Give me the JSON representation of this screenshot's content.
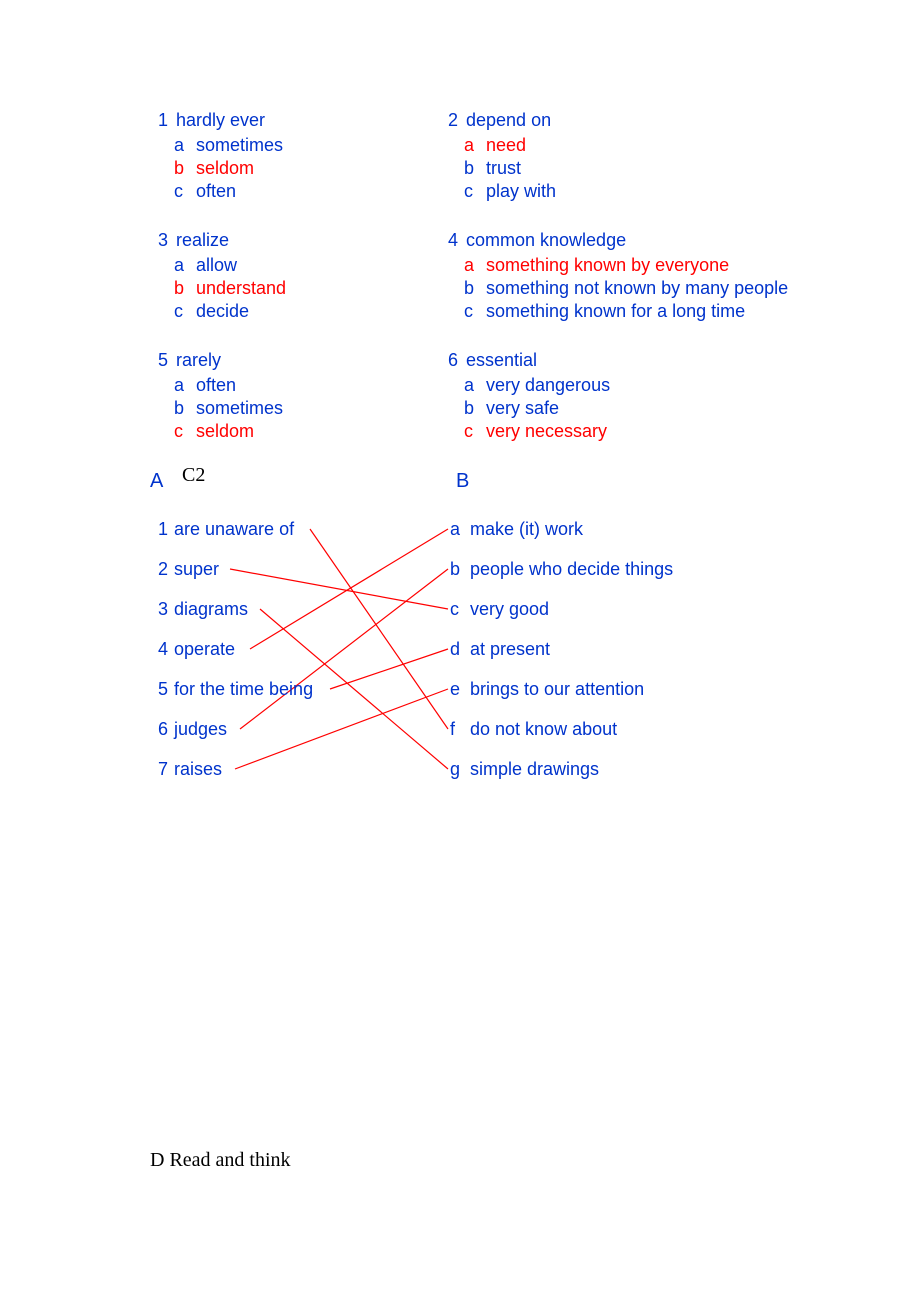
{
  "mc": {
    "q1": {
      "num": "1",
      "text": "hardly ever",
      "a": "sometimes",
      "b": "seldom",
      "c": "often",
      "correct": "b"
    },
    "q2": {
      "num": "2",
      "text": "depend on",
      "a": "need",
      "b": "trust",
      "c": "play with",
      "correct": "a"
    },
    "q3": {
      "num": "3",
      "text": "realize",
      "a": "allow",
      "b": "understand",
      "c": "decide",
      "correct": "b"
    },
    "q4": {
      "num": "4",
      "text": "common knowledge",
      "a": "something known by everyone",
      "b": "something not known by many people",
      "c": "something known for a long time",
      "correct": "a"
    },
    "q5": {
      "num": "5",
      "text": "rarely",
      "a": "often",
      "b": "sometimes",
      "c": "seldom",
      "correct": "c"
    },
    "q6": {
      "num": "6",
      "text": "essential",
      "a": "very dangerous",
      "b": "very safe",
      "c": "very necessary",
      "correct": "c"
    }
  },
  "section_c2_label": "C2",
  "match": {
    "header_a": "A",
    "header_b": "B",
    "left": {
      "1": {
        "num": "1",
        "text": "are unaware of"
      },
      "2": {
        "num": "2",
        "text": "super"
      },
      "3": {
        "num": "3",
        "text": "diagrams"
      },
      "4": {
        "num": "4",
        "text": "operate"
      },
      "5": {
        "num": "5",
        "text": "for the time being"
      },
      "6": {
        "num": "6",
        "text": "judges"
      },
      "7": {
        "num": "7",
        "text": "raises"
      }
    },
    "right": {
      "a": {
        "letter": "a",
        "text": "make (it) work"
      },
      "b": {
        "letter": "b",
        "text": "people who decide things"
      },
      "c": {
        "letter": "c",
        "text": "very good"
      },
      "d": {
        "letter": "d",
        "text": "at present"
      },
      "e": {
        "letter": "e",
        "text": "brings to our attention"
      },
      "f": {
        "letter": "f",
        "text": "do not know about"
      },
      "g": {
        "letter": "g",
        "text": "simple drawings"
      }
    },
    "connections": [
      {
        "from": 1,
        "to": "f"
      },
      {
        "from": 2,
        "to": "c"
      },
      {
        "from": 3,
        "to": "g"
      },
      {
        "from": 4,
        "to": "a"
      },
      {
        "from": 5,
        "to": "d"
      },
      {
        "from": 6,
        "to": "b"
      },
      {
        "from": 7,
        "to": "e"
      }
    ],
    "line_color": "#ff0000"
  },
  "section_d": "D Read and think"
}
